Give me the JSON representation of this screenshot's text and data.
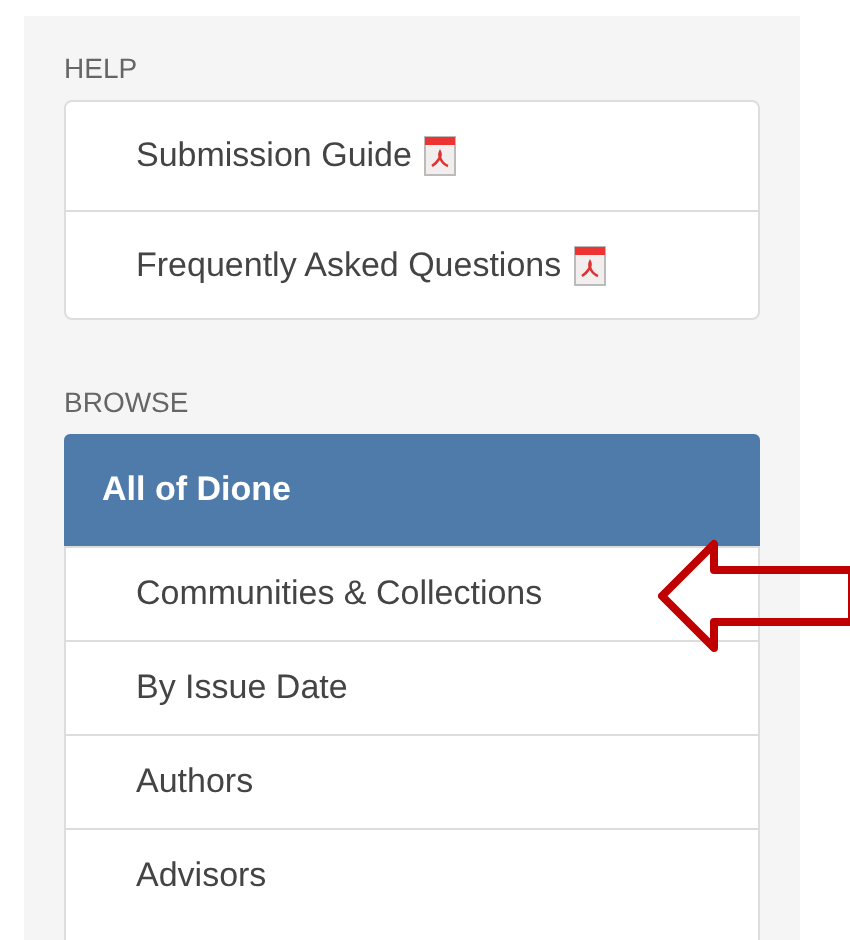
{
  "help": {
    "heading": "HELP",
    "items": [
      {
        "label": "Submission Guide",
        "kind": "pdf"
      },
      {
        "label": "Frequently Asked Questions",
        "kind": "pdf"
      }
    ]
  },
  "browse": {
    "heading": "BROWSE",
    "header": "All of Dione",
    "items": [
      {
        "label": "Communities & Collections",
        "pointed": true
      },
      {
        "label": "By Issue Date",
        "pointed": false
      },
      {
        "label": "Authors",
        "pointed": false
      },
      {
        "label": "Advisors",
        "pointed": false
      }
    ]
  }
}
